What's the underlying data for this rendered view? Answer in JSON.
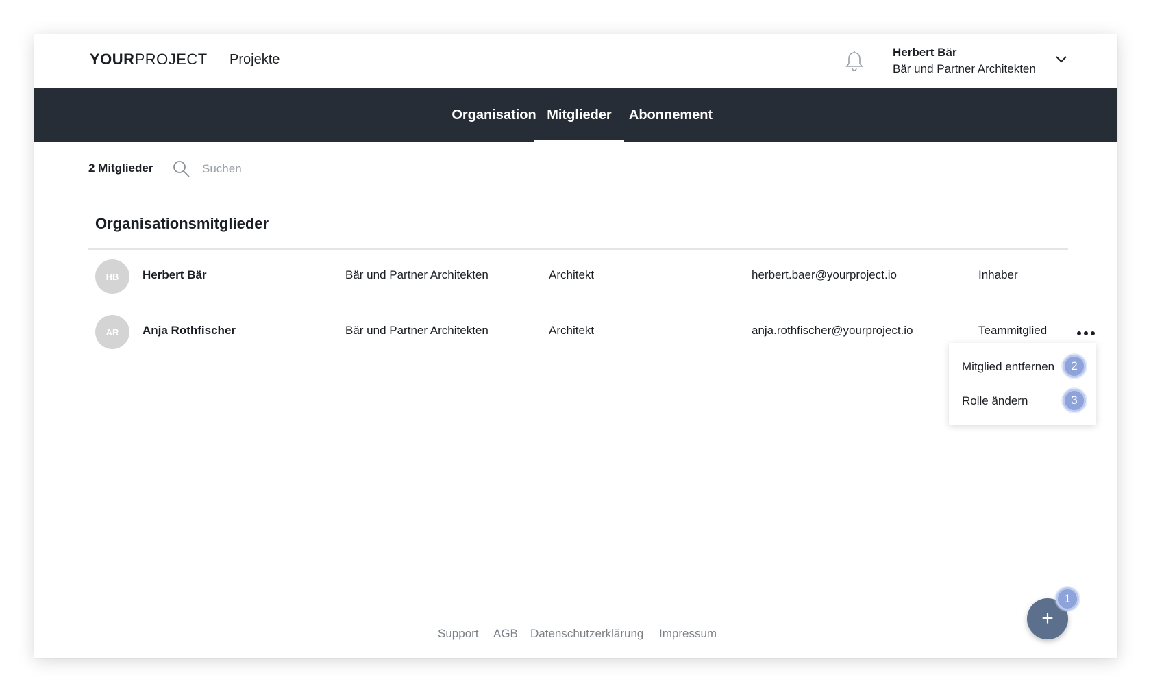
{
  "header": {
    "logo_bold": "YOUR",
    "logo_light": "PROJECT",
    "nav_projects": "Projekte",
    "user": {
      "name": "Herbert Bär",
      "org": "Bär und Partner Architekten"
    }
  },
  "tabs": [
    {
      "label": "Organisation",
      "active": false
    },
    {
      "label": "Mitglieder",
      "active": true
    },
    {
      "label": "Abonnement",
      "active": false
    }
  ],
  "toolbar": {
    "member_count": "2 Mitglieder",
    "search_placeholder": "Suchen"
  },
  "section_title": "Organisationsmitglieder",
  "members": [
    {
      "initials": "HB",
      "name": "Herbert Bär",
      "org": "Bär und Partner Architekten",
      "role": "Architekt",
      "email": "herbert.baer@yourproject.io",
      "status": "Inhaber"
    },
    {
      "initials": "AR",
      "name": "Anja Rothfischer",
      "org": "Bär und Partner Architekten",
      "role": "Architekt",
      "email": "anja.rothfischer@yourproject.io",
      "status": "Teammitglied"
    }
  ],
  "context_menu": {
    "items": [
      {
        "label": "Mitglied entfernen",
        "badge": "2"
      },
      {
        "label": "Rolle ändern",
        "badge": "3"
      }
    ]
  },
  "footer": {
    "links": [
      "Support",
      "AGB",
      "Datenschutzerklärung",
      "Impressum"
    ]
  },
  "fab": {
    "symbol": "+",
    "badge": "1"
  },
  "colors": {
    "tabbar_bg": "#262d37",
    "fab_bg": "#5c6f8c",
    "badge_bg": "#8ea3da",
    "avatar_bg": "#d4d4d4"
  }
}
